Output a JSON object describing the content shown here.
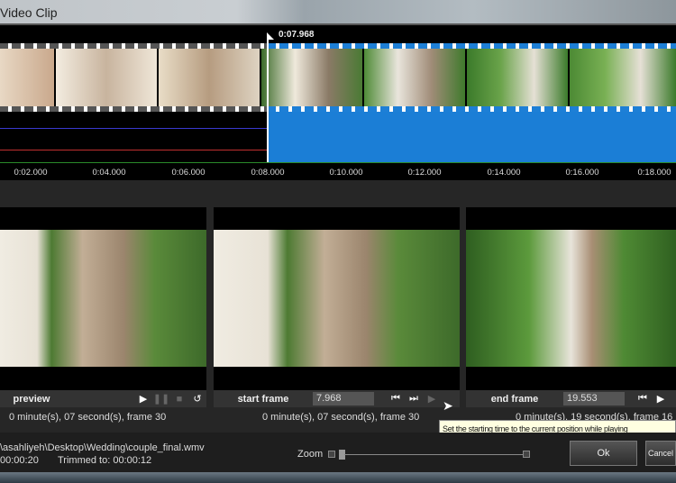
{
  "window": {
    "title": "Video Clip"
  },
  "timeline": {
    "playhead": "0:07.968",
    "ticks": [
      "0:02.000",
      "0:04.000",
      "0:06.000",
      "0:08.000",
      "0:10.000",
      "0:12.000",
      "0:14.000",
      "0:16.000",
      "0:18.000"
    ],
    "selection_color": "#1b7ed6"
  },
  "preview": {
    "label": "preview",
    "info": "0 minute(s), 07 second(s), frame 30"
  },
  "start": {
    "label": "start frame",
    "value": "7.968",
    "info": "0 minute(s), 07 second(s), frame 30"
  },
  "end": {
    "label": "end frame",
    "value": "19.553",
    "info": "0 minute(s), 19 second(s), frame 16"
  },
  "tooltip": "Set the starting time to the current position while playing",
  "footer": {
    "path": "\\asahliyeh\\Desktop\\Wedding\\couple_final.wmv",
    "duration": "00:00:20",
    "trimmed": "Trimmed to: 00:00:12",
    "zoom_label": "Zoom",
    "ok": "Ok",
    "cancel": "Cancel"
  }
}
